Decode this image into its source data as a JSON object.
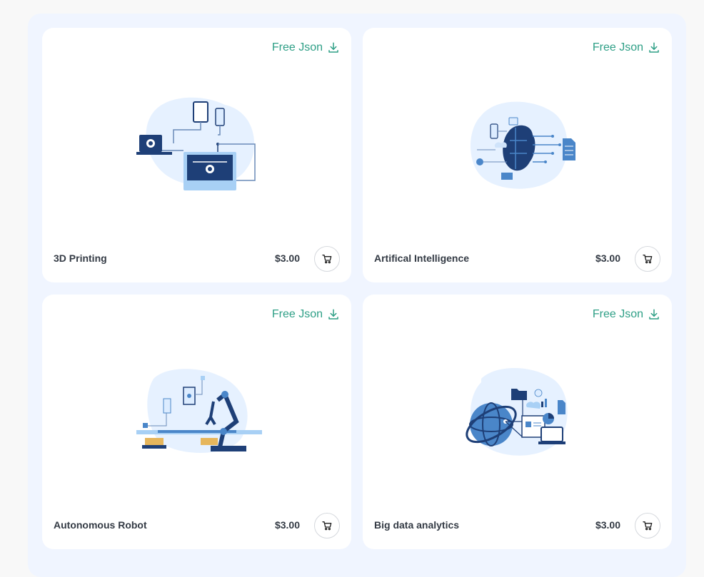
{
  "colors": {
    "accent": "#2e9f86",
    "text": "#333a44",
    "panel_bg": "#f0f5ff",
    "card_bg": "#ffffff",
    "illus_dark": "#1e3f77",
    "illus_mid": "#4a86c9",
    "illus_light": "#dcecff"
  },
  "cards": [
    {
      "title": "3D Printing",
      "price": "$3.00",
      "free_label": "Free Json",
      "icon": "download-icon",
      "cart_icon": "cart-icon"
    },
    {
      "title": "Artifical Intelligence",
      "price": "$3.00",
      "free_label": "Free Json",
      "icon": "download-icon",
      "cart_icon": "cart-icon"
    },
    {
      "title": "Autonomous Robot",
      "price": "$3.00",
      "free_label": "Free Json",
      "icon": "download-icon",
      "cart_icon": "cart-icon"
    },
    {
      "title": "Big data analytics",
      "price": "$3.00",
      "free_label": "Free Json",
      "icon": "download-icon",
      "cart_icon": "cart-icon"
    }
  ]
}
